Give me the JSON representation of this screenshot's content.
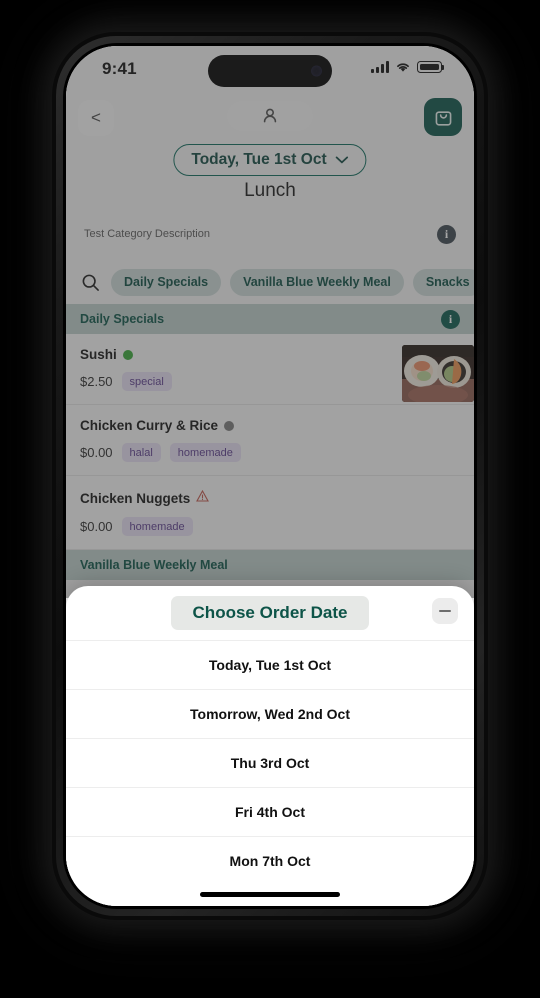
{
  "status_bar": {
    "time": "9:41",
    "signal_icon": "cellular-signal-icon",
    "wifi_icon": "wifi-icon",
    "battery_icon": "battery-full-icon"
  },
  "nav": {
    "back_label": "<",
    "back_icon": "chevron-left-icon",
    "profile_icon": "person-icon",
    "cart_icon": "shopping-bag-icon",
    "cart_color": "#0d5449"
  },
  "date_selector": {
    "label": "Today, Tue 1st Oct",
    "chevron_icon": "chevron-down-icon",
    "border_color": "#0d6b5c"
  },
  "category": {
    "title": "Lunch",
    "description": "Test Category Description",
    "info_icon": "info-circle-icon"
  },
  "filter_row": {
    "search_icon": "search-icon",
    "chips": [
      {
        "label": "Daily Specials"
      },
      {
        "label": "Vanilla Blue Weekly Meal"
      },
      {
        "label": "Snacks"
      }
    ]
  },
  "menu": {
    "sections": [
      {
        "title": "Daily Specials",
        "info_icon": "info-circle-icon",
        "items": [
          {
            "name": "Sushi",
            "diet_dot": "green",
            "diet_icon": "green-dot-icon",
            "price": "$2.50",
            "tags": [
              "special"
            ],
            "thumbnail": "sushi-photo"
          },
          {
            "name": "Chicken Curry & Rice",
            "diet_dot": "grey",
            "diet_icon": "grey-dot-icon",
            "price": "$0.00",
            "tags": [
              "halal",
              "homemade"
            ],
            "thumbnail": ""
          },
          {
            "name": "Chicken Nuggets",
            "diet_dot": "warning",
            "diet_icon": "allergen-warning-icon",
            "price": "$0.00",
            "tags": [
              "homemade"
            ],
            "thumbnail": ""
          }
        ]
      },
      {
        "title": "Vanilla Blue Weekly Meal",
        "info_icon": "",
        "items": []
      }
    ]
  },
  "sheet": {
    "title": "Choose Order Date",
    "collapse_icon": "minus-icon",
    "options": [
      {
        "label": "Today, Tue 1st Oct"
      },
      {
        "label": "Tomorrow, Wed 2nd Oct"
      },
      {
        "label": "Thu 3rd Oct"
      },
      {
        "label": "Fri 4th Oct"
      },
      {
        "label": "Mon 7th Oct"
      }
    ]
  },
  "colors": {
    "brand_teal": "#0d5448",
    "band": "#bcccc8",
    "tag_bg": "#e4dcf0",
    "tag_text": "#5b3d8c"
  }
}
